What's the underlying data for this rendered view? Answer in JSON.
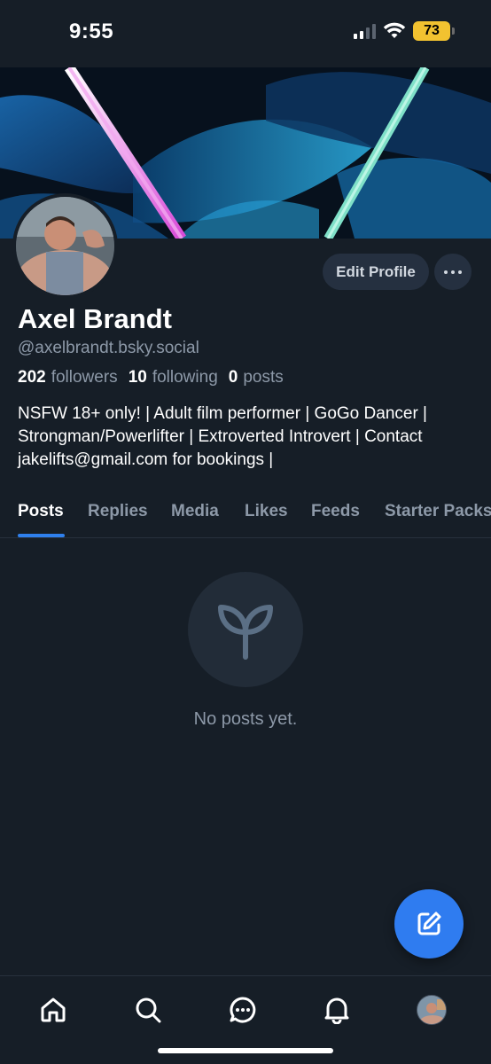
{
  "status_bar": {
    "time": "9:55",
    "battery": "73",
    "icons": [
      "signal-icon",
      "wifi-icon",
      "battery-icon"
    ]
  },
  "profile": {
    "display_name": "Axel Brandt",
    "handle": "@axelbrandt.bsky.social",
    "followers_count": "202",
    "followers_label": "followers",
    "following_count": "10",
    "following_label": "following",
    "posts_count": "0",
    "posts_label": "posts",
    "bio": "NSFW 18+ only! | Adult film performer | GoGo Dancer | Strongman/Powerlifter | Extroverted Introvert | Contact jakelifts@gmail.com for bookings |",
    "edit_profile_label": "Edit Profile"
  },
  "tabs": [
    {
      "label": "Posts",
      "active": true
    },
    {
      "label": "Replies",
      "active": false
    },
    {
      "label": "Media",
      "active": false
    },
    {
      "label": "Likes",
      "active": false
    },
    {
      "label": "Feeds",
      "active": false
    },
    {
      "label": "Starter Packs",
      "active": false
    }
  ],
  "empty_state": {
    "icon": "sprout-icon",
    "text": "No posts yet."
  },
  "fab": {
    "icon": "compose-icon"
  },
  "bottom_nav": {
    "items": [
      "home-icon",
      "search-icon",
      "chat-icon",
      "bell-icon",
      "profile-avatar"
    ]
  },
  "colors": {
    "background": "#161e27",
    "accent": "#2f80ed",
    "muted_text": "#8d99a8",
    "button_bg": "#253040",
    "battery": "#f2c230"
  }
}
